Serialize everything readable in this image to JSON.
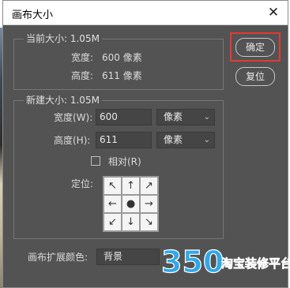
{
  "dialog": {
    "title": "画布大小"
  },
  "current_size": {
    "heading": "当前大小: 1.05M",
    "width_label": "宽度:",
    "width_value": "600 像素",
    "height_label": "高度:",
    "height_value": "611 像素"
  },
  "buttons": {
    "ok": "确定",
    "reset": "复位"
  },
  "new_size": {
    "heading": "新建大小: 1.05M",
    "width_label": "宽度(W):",
    "width_value": "600",
    "width_unit": "像素",
    "height_label": "高度(H):",
    "height_value": "611",
    "height_unit": "像素",
    "relative_label": "相对(R)",
    "anchor_label": "定位:"
  },
  "extension": {
    "label": "画布扩展颜色:",
    "value": "背景"
  },
  "watermark": {
    "number": "350",
    "text": "淘宝装修平台"
  },
  "colors": {
    "dialog_bg": "#535353",
    "highlight": "#e53935"
  }
}
